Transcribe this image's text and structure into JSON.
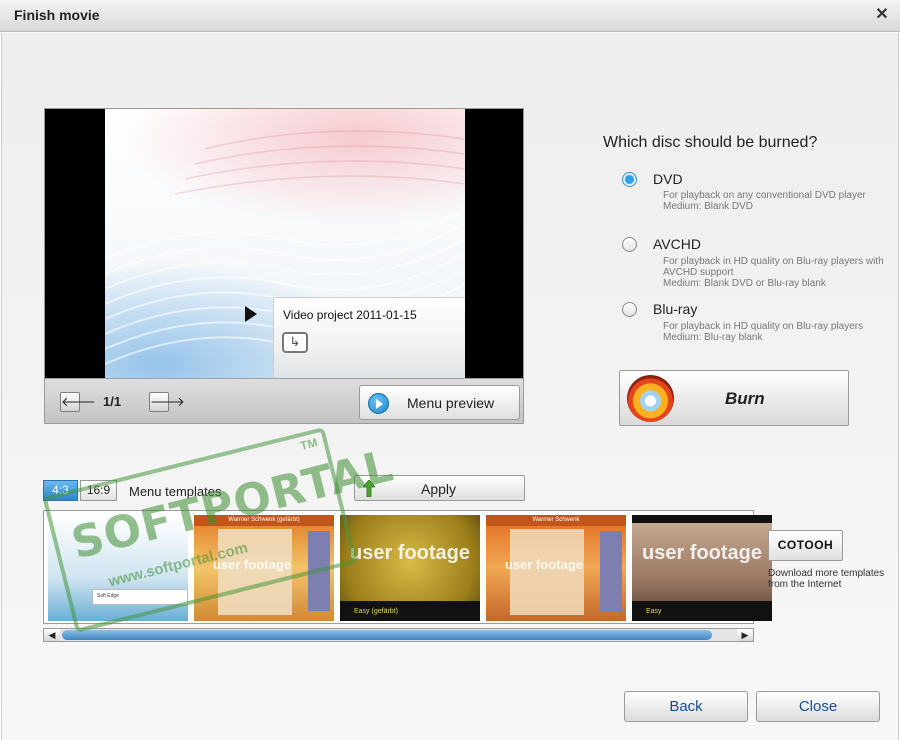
{
  "window": {
    "title": "Finish movie",
    "close_glyph": "✕"
  },
  "preview": {
    "menu_title": "Video project 2011-01-15",
    "page_indicator": "1/1",
    "prev_glyph": "🡐",
    "next_glyph": "🡒",
    "menu_preview_label": "Menu preview",
    "return_glyph": "↳"
  },
  "disc": {
    "question": "Which disc should be burned?",
    "selected": "DVD",
    "options": [
      {
        "label": "DVD",
        "desc": "For playback on any conventional DVD player\nMedium: Blank DVD"
      },
      {
        "label": "AVCHD",
        "desc": "For playback in HD quality on Blu-ray players with AVCHD support\nMedium: Blank DVD or Blu-ray blank"
      },
      {
        "label": "Blu-ray",
        "desc": "For playback in HD quality on Blu-ray players\nMedium: Blu-ray blank"
      }
    ],
    "burn_label": "Burn"
  },
  "templates": {
    "aspect_options": [
      "4:3",
      "16:9"
    ],
    "active_aspect": "4:3",
    "label": "Menu templates",
    "apply_label": "Apply",
    "items": [
      {
        "header": "",
        "big_text": "",
        "footer": "Soft Edge"
      },
      {
        "header": "Warmer Schwenk (gefärbt)",
        "big_text": "user footage",
        "footer": ""
      },
      {
        "header": "",
        "big_text": "user footage",
        "footer": "Easy (gefärbt)"
      },
      {
        "header": "Warmer Schwenk",
        "big_text": "user footage",
        "footer": ""
      },
      {
        "header": "",
        "big_text": "user footage",
        "footer": "Easy"
      }
    ],
    "scroll_left_glyph": "◀",
    "scroll_right_glyph": "▶"
  },
  "cotooh": {
    "button_label": "COTOOH",
    "download_text": "Download more templates from the Internet"
  },
  "watermark": {
    "main": "SOFTPORTAL",
    "sub": "www.softportal.com",
    "tm": "TM"
  },
  "footer": {
    "back_label": "Back",
    "close_label": "Close"
  }
}
